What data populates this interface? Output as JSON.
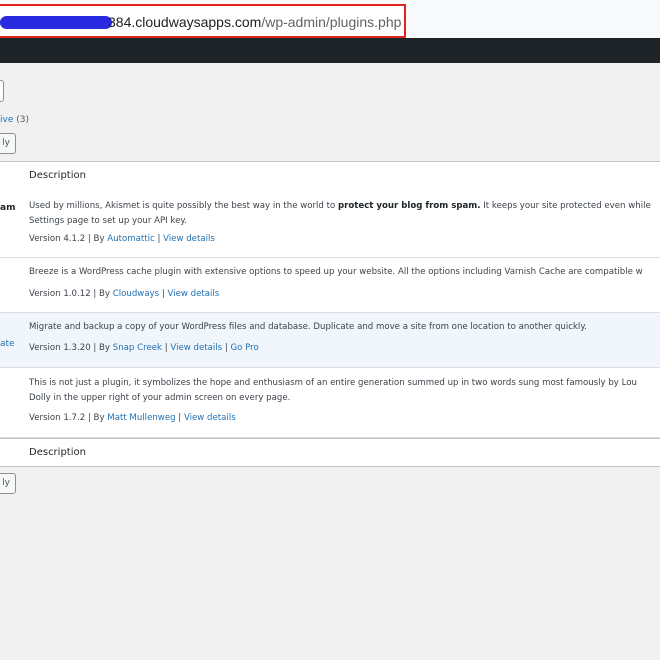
{
  "browser": {
    "url_host": "384.cloudwaysapps.com",
    "url_path": "/wp-admin/plugins.php"
  },
  "filters": {
    "inactive_label": "ive",
    "inactive_count": "(3)",
    "apply_label": "ly"
  },
  "table": {
    "header_description": "Description",
    "footer_description": "Description",
    "rows": [
      {
        "name_fragment": "am",
        "desc_line1_pre": "Used by millions, Akismet is quite possibly the best way in the world to ",
        "desc_line1_bold": "protect your blog from spam.",
        "desc_line1_post": " It keeps your site protected even while",
        "desc_line2": "Settings page to set up your API key.",
        "version": "Version 4.1.2 | By ",
        "author": "Automattic",
        "sep": " | ",
        "details": "View details"
      },
      {
        "desc_line1": "Breeze is a WordPress cache plugin with extensive options to speed up your website. All the options including Varnish Cache are compatible w",
        "version": "Version 1.0.12 | By ",
        "author": "Cloudways",
        "sep": " | ",
        "details": "View details"
      },
      {
        "name_fragment": "ate",
        "desc_line1": "Migrate and backup a copy of your WordPress files and database. Duplicate and move a site from one location to another quickly.",
        "version": "Version 1.3.20 | By ",
        "author": "Snap Creek",
        "sep": " | ",
        "details": "View details",
        "sep2": " | ",
        "extra": "Go Pro"
      },
      {
        "desc_line1": "This is not just a plugin, it symbolizes the hope and enthusiasm of an entire generation summed up in two words sung most famously by Lou",
        "desc_line2": "Dolly in the upper right of your admin screen on every page.",
        "version": "Version 1.7.2 | By ",
        "author": "Matt Mullenweg",
        "sep": " | ",
        "details": "View details"
      }
    ]
  }
}
